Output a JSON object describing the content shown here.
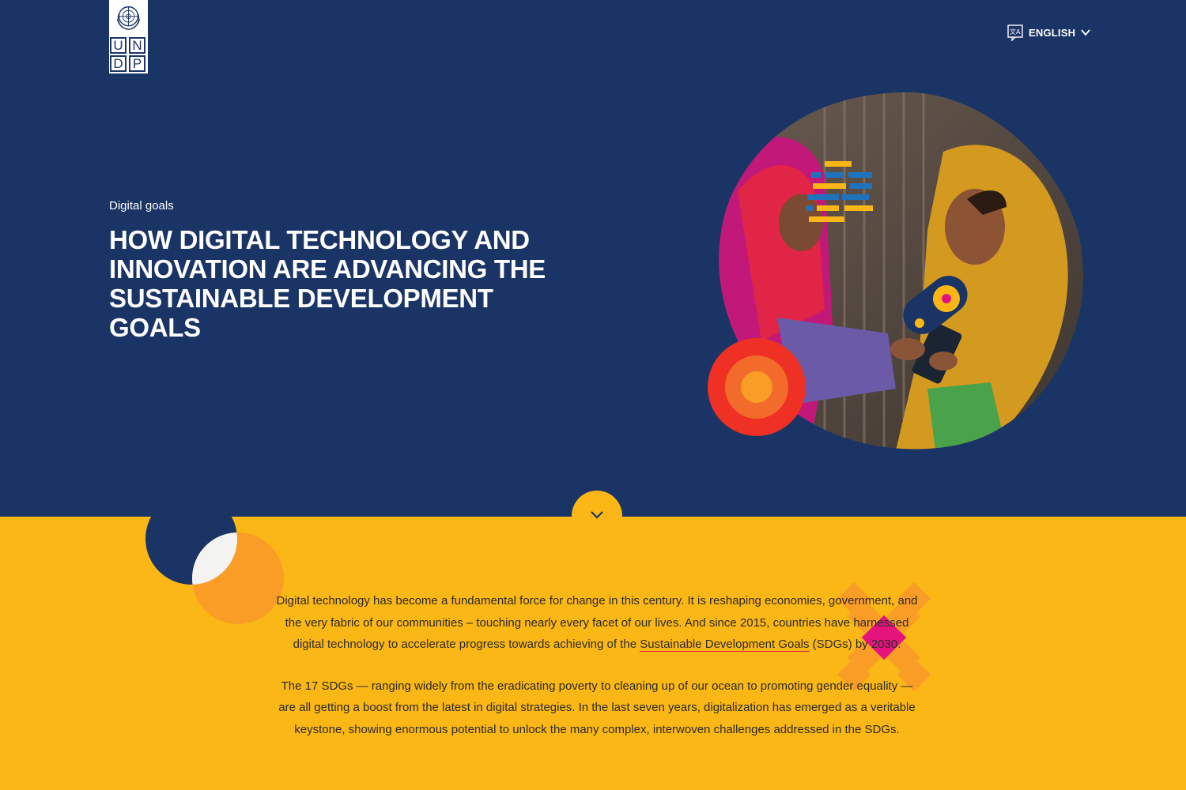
{
  "header": {
    "logo_letters": [
      "U",
      "N",
      "D",
      "P"
    ],
    "language": {
      "label": "ENGLISH",
      "icon": "translate-icon",
      "chevron": "chevron-down-icon"
    }
  },
  "hero": {
    "eyebrow": "Digital goals",
    "title": "HOW DIGITAL TECHNOLOGY AND INNOVATION ARE ADVANCING THE SUSTAINABLE DEVELOPMENT GOALS",
    "image_icon": "women-with-tablet-photo"
  },
  "scroll_button": {
    "icon": "chevron-down-icon"
  },
  "intro": {
    "p1_before": "Digital technology has become a fundamental force for change in this century. It is reshaping economies, government, and the very fabric of our communities – touching nearly every facet of our lives. And since 2015, countries have harnessed digital technology to accelerate progress towards achieving of the ",
    "p1_link": "Sustainable Development Goals",
    "p1_after": " (SDGs) by 2030.",
    "p2": "The 17 SDGs — ranging widely from the eradicating poverty to cleaning up of our ocean to promoting gender equality — are all getting a boost from the latest in digital strategies. In the last seven years, digitalization has emerged as a veritable keystone, showing enormous potential to unlock the many complex, interwoven challenges addressed in the SDGs."
  },
  "colors": {
    "navy": "#1a3466",
    "yellow": "#fbb715",
    "orange": "#f99d26",
    "red": "#ee3124",
    "magenta": "#e5147d",
    "link_underline": "#e5243b"
  }
}
